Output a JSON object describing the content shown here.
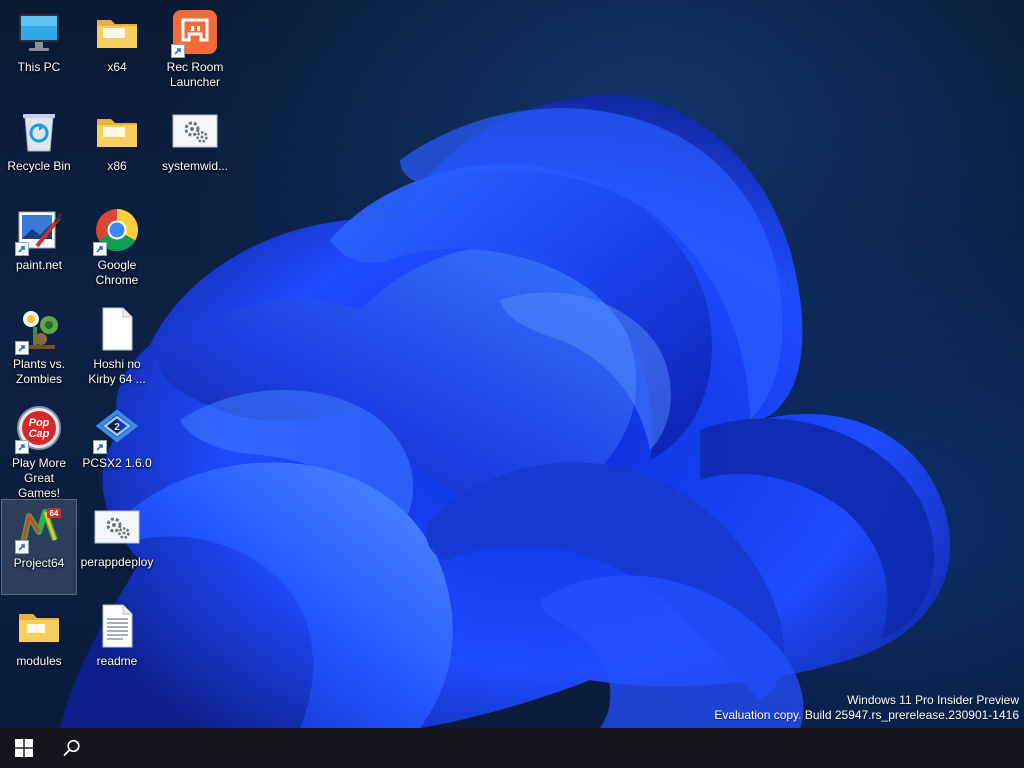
{
  "desktop": {
    "icons": [
      {
        "label_line1": "This PC",
        "label_line2": "",
        "icon": "monitor-icon",
        "shortcut": false
      },
      {
        "label_line1": "x64",
        "label_line2": "",
        "icon": "folder-icon",
        "shortcut": false
      },
      {
        "label_line1": "Rec Room",
        "label_line2": "Launcher",
        "icon": "rec-room-icon",
        "shortcut": true
      },
      {
        "label_line1": "Recycle Bin",
        "label_line2": "",
        "icon": "recycle-bin-icon",
        "shortcut": false
      },
      {
        "label_line1": "x86",
        "label_line2": "",
        "icon": "folder-icon",
        "shortcut": false
      },
      {
        "label_line1": "systemwid...",
        "label_line2": "",
        "icon": "gear-file-icon",
        "shortcut": false
      },
      {
        "label_line1": "paint.net",
        "label_line2": "",
        "icon": "paint-net-icon",
        "shortcut": true
      },
      {
        "label_line1": "Google",
        "label_line2": "Chrome",
        "icon": "chrome-icon",
        "shortcut": true
      },
      {
        "label_line1": "Plants vs.",
        "label_line2": "Zombies",
        "icon": "plants-vs-zombies-icon",
        "shortcut": true
      },
      {
        "label_line1": "Hoshi no",
        "label_line2": "Kirby 64 ...",
        "icon": "blank-file-icon",
        "shortcut": false
      },
      {
        "label_line1": "Play More",
        "label_line2": "Great Games!",
        "icon": "popcap-icon",
        "shortcut": true
      },
      {
        "label_line1": "PCSX2 1.6.0",
        "label_line2": "",
        "icon": "pcsx2-icon",
        "shortcut": true
      },
      {
        "label_line1": "Project64",
        "label_line2": "",
        "icon": "project64-icon",
        "shortcut": true,
        "selected": true
      },
      {
        "label_line1": "perappdeploy",
        "label_line2": "",
        "icon": "gear-file-icon",
        "shortcut": false
      },
      {
        "label_line1": "modules",
        "label_line2": "",
        "icon": "folder-icon",
        "shortcut": false
      },
      {
        "label_line1": "readme",
        "label_line2": "",
        "icon": "text-file-icon",
        "shortcut": false
      }
    ]
  },
  "watermark": {
    "line1": "Windows 11 Pro Insider Preview",
    "line2": "Evaluation copy. Build 25947.rs_prerelease.230901-1416"
  },
  "taskbar": {
    "start_icon": "windows-logo-icon",
    "search_icon": "search-icon"
  },
  "colors": {
    "desktop_background": "#0c2145",
    "wallpaper_bloom": "#1f4bff",
    "taskbar": "#15161a",
    "folder": "#f4c95d",
    "rec_room": "#f26b3a"
  }
}
